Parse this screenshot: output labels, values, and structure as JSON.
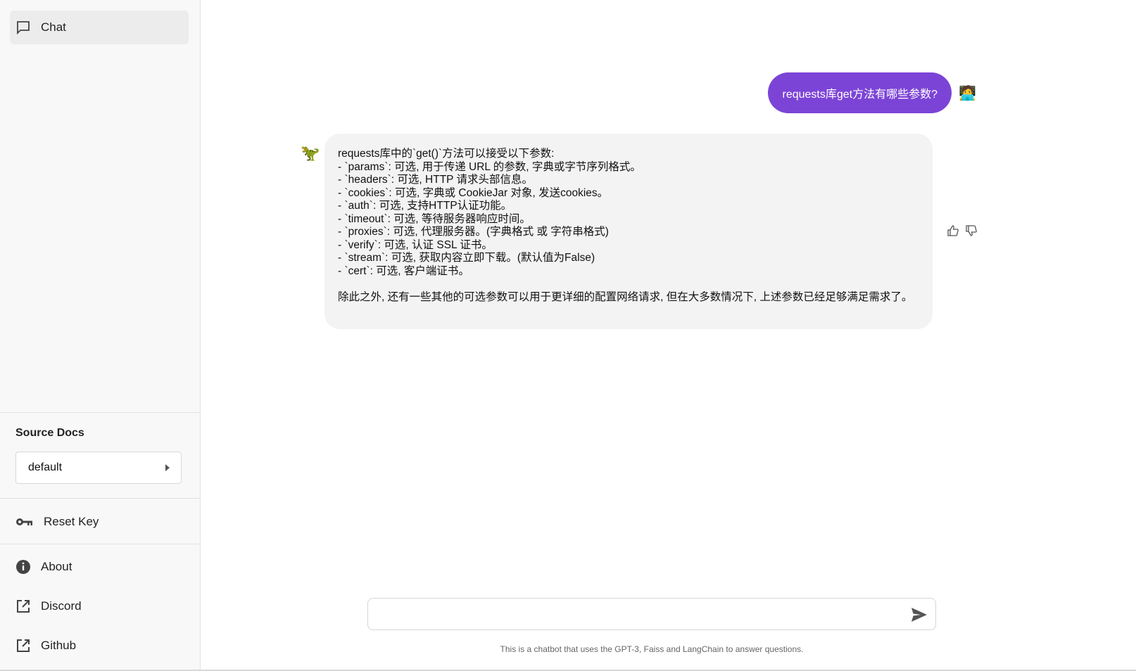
{
  "sidebar": {
    "chat_label": "Chat",
    "source_docs_title": "Source Docs",
    "source_select_value": "default",
    "reset_key_label": "Reset Key",
    "about_label": "About",
    "discord_label": "Discord",
    "github_label": "Github"
  },
  "conversation": {
    "user_message": "requests库get方法有哪些参数?",
    "user_avatar": "🧑‍💻",
    "bot_avatar": "🦖",
    "bot_lines": [
      "requests库中的`get()`方法可以接受以下参数:",
      "- `params`: 可选, 用于传递 URL 的参数, 字典或字节序列格式。",
      "- `headers`: 可选, HTTP 请求头部信息。",
      "- `cookies`: 可选, 字典或 CookieJar 对象, 发送cookies。",
      "- `auth`: 可选, 支持HTTP认证功能。",
      "- `timeout`: 可选, 等待服务器响应时间。",
      "- `proxies`: 可选, 代理服务器。(字典格式 或 字符串格式)",
      "- `verify`: 可选, 认证 SSL 证书。",
      "- `stream`: 可选, 获取内容立即下载。(默认值为False)",
      "- `cert`: 可选, 客户端证书。"
    ],
    "bot_closing": "除此之外, 还有一些其他的可选参数可以用于更详细的配置网络请求, 但在大多数情况下, 上述参数已经足够满足需求了。"
  },
  "composer": {
    "placeholder": "",
    "footer_note": "This is a chatbot that uses the GPT-3, Faiss and LangChain to answer questions."
  },
  "colors": {
    "accent": "#7c44d6",
    "bot_bubble": "#f3f3f3",
    "sidebar_bg": "#f8f8f8"
  }
}
